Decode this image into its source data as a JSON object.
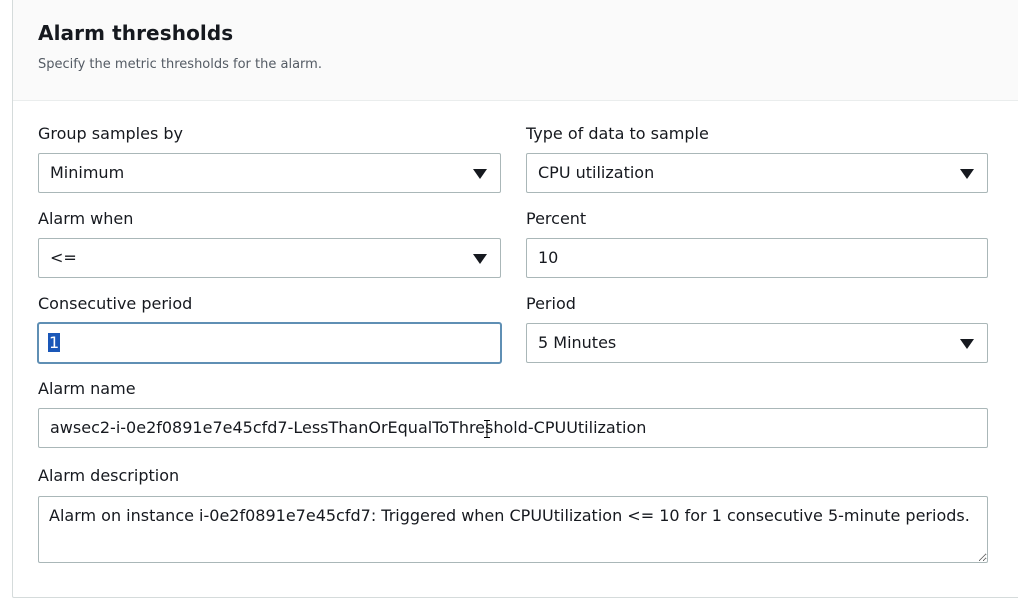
{
  "section": {
    "title": "Alarm thresholds",
    "description": "Specify the metric thresholds for the alarm."
  },
  "group_samples": {
    "label": "Group samples by",
    "value": "Minimum"
  },
  "data_type": {
    "label": "Type of data to sample",
    "value": "CPU utilization"
  },
  "alarm_when": {
    "label": "Alarm when",
    "value": "<="
  },
  "percent": {
    "label": "Percent",
    "value": "10"
  },
  "consecutive_period": {
    "label": "Consecutive period",
    "value": "1"
  },
  "period": {
    "label": "Period",
    "value": "5 Minutes"
  },
  "alarm_name": {
    "label": "Alarm name",
    "value": "awsec2-i-0e2f0891e7e45cfd7-LessThanOrEqualToThreshold-CPUUtilization"
  },
  "alarm_description": {
    "label": "Alarm description",
    "value": "Alarm on instance i-0e2f0891e7e45cfd7: Triggered when CPUUtilization <= 10 for 1 consecutive 5-minute periods."
  },
  "icons": {
    "dropdown": "caret-down-icon",
    "resize": "resize-handle-icon",
    "cursor": "text-cursor-icon"
  },
  "colors": {
    "selection": "#1a57b8",
    "focus_border": "#5f8fb4",
    "field_border": "#aab7b8"
  }
}
